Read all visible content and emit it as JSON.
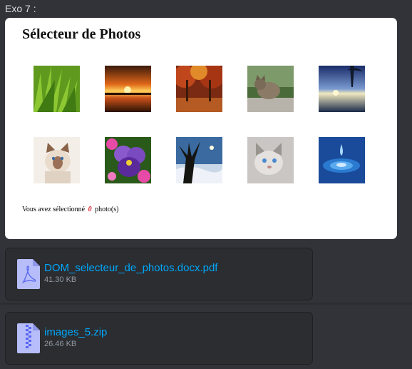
{
  "message": {
    "label": "Exo 7 :"
  },
  "embed": {
    "title": "Sélecteur de Photos",
    "status_prefix": "Vous avez sélectionné",
    "selected_count": "0",
    "status_suffix": "photo(s)",
    "photos": [
      {
        "icon": "grass-photo-icon"
      },
      {
        "icon": "sunset-lake-photo-icon"
      },
      {
        "icon": "autumn-park-photo-icon"
      },
      {
        "icon": "cat-on-fence-photo-icon"
      },
      {
        "icon": "seaside-sunset-photo-icon"
      },
      {
        "icon": "siamese-kitten-photo-icon"
      },
      {
        "icon": "pansy-flower-photo-icon"
      },
      {
        "icon": "tree-silhouette-photo-icon"
      },
      {
        "icon": "blue-eyed-cat-photo-icon"
      },
      {
        "icon": "water-drop-photo-icon"
      }
    ]
  },
  "attachments": [
    {
      "name": "DOM_selecteur_de_photos.docx.pdf",
      "size": "41.30 KB",
      "icon": "pdf-file-icon"
    },
    {
      "name": "images_5.zip",
      "size": "26.46 KB",
      "icon": "zip-file-icon"
    }
  ],
  "colors": {
    "link": "#00a8fc",
    "background": "#313338",
    "count": "#e0222f"
  }
}
